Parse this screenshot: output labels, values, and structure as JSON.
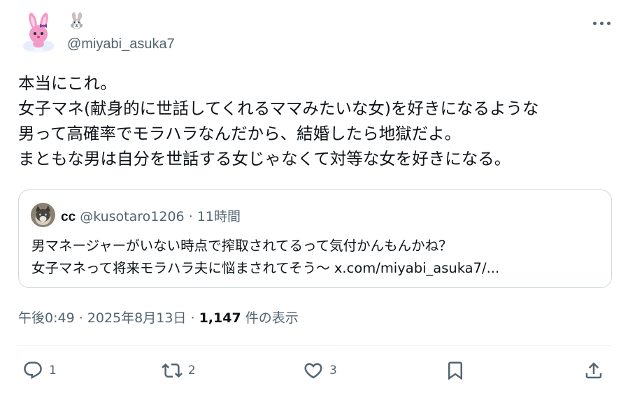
{
  "post": {
    "display_name": "🐰",
    "handle": "@miyabi_asuka7",
    "text_lines": [
      "本当にこれ。",
      "女子マネ(献身的に世話してくれるママみたいな女)を好きになるような",
      "男って高確率でモラハラなんだから、結婚したら地獄だよ。",
      "まともな男は自分を世話する女じゃなくて対等な女を好きになる。"
    ],
    "time": "午後0:49",
    "date": "2025年8月13日",
    "separator": "·",
    "views_count": "1,147",
    "views_label": "件の表示"
  },
  "quote": {
    "name": "cc",
    "handle": "@kusotaro1206",
    "separator": "·",
    "time": "11時間",
    "text_lines": [
      "男マネージャーがいない時点で搾取されてるって気付かんもんかね？",
      "女子マネって将来モラハラ夫に悩まされてそう～ x.com/miyabi_asuka7/..."
    ]
  },
  "actions": {
    "reply_count": "1",
    "retweet_count": "2",
    "like_count": "3"
  },
  "icons": [
    "more-icon",
    "reply-icon",
    "retweet-icon",
    "like-icon",
    "bookmark-icon",
    "share-icon"
  ],
  "colors": {
    "text": "#0f1419",
    "secondary": "#536471",
    "border": "#cfd9de",
    "avatar_pink": "#f39ac8"
  }
}
